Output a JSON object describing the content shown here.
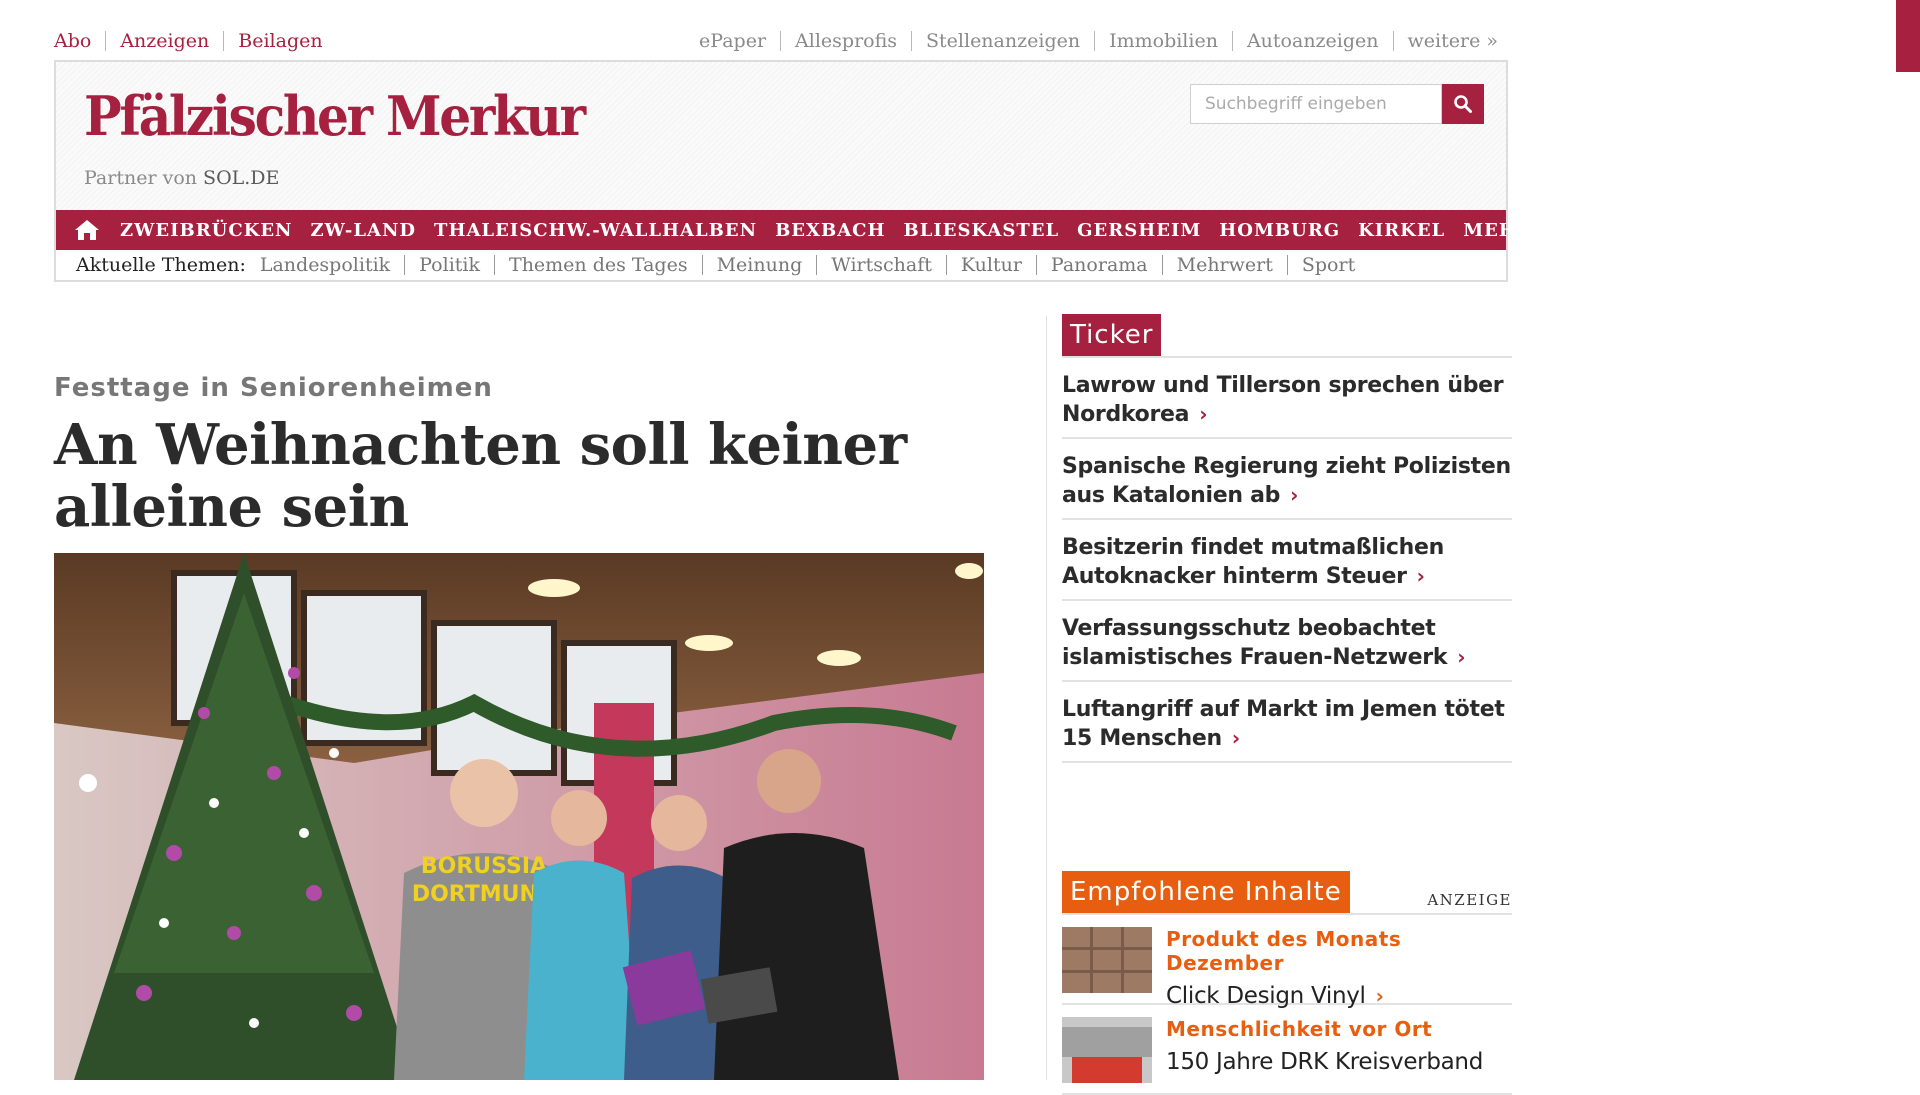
{
  "topbar": {
    "left_links": [
      "Abo",
      "Anzeigen",
      "Beilagen"
    ],
    "right_links": [
      "ePaper",
      "Allesprofis",
      "Stellenanzeigen",
      "Immobilien",
      "Autoanzeigen",
      "weitere »"
    ]
  },
  "header": {
    "logo": "Pfälzischer Merkur",
    "partner_prefix": "Partner von",
    "partner_name": "SOL.DE",
    "search_placeholder": "Suchbegriff eingeben"
  },
  "mainnav": {
    "items": [
      "ZWEIBRÜCKEN",
      "ZW-LAND",
      "THALEISCHW.-WALLHALBEN",
      "BEXBACH",
      "BLIESKASTEL",
      "GERSHEIM",
      "HOMBURG",
      "KIRKEL",
      "MEHR"
    ]
  },
  "themes": {
    "label": "Aktuelle Themen:",
    "items": [
      "Landespolitik",
      "Politik",
      "Themen des Tages",
      "Meinung",
      "Wirtschaft",
      "Kultur",
      "Panorama",
      "Mehrwert",
      "Sport"
    ]
  },
  "article": {
    "kicker": "Festtage in Seniorenheimen",
    "headline": "An Weihnachten soll keiner alleine sein",
    "photo_shirt_text_1": "BORUSSIA",
    "photo_shirt_text_2": "DORTMUND"
  },
  "ticker": {
    "title": "Ticker",
    "items": [
      "Lawrow und Tillerson sprechen über Nordkorea",
      "Spanische Regierung zieht Polizisten aus Katalonien ab",
      "Besitzerin findet mutmaßlichen Autoknacker hinterm Steuer",
      "Verfassungsschutz beobachtet islamistisches Frauen-Netzwerk",
      "Luftangriff auf Markt im Jemen tötet 15 Menschen"
    ]
  },
  "recommended": {
    "title": "Empfohlene Inhalte",
    "ad_label": "ANZEIGE",
    "items": [
      {
        "kicker": "Produkt des Monats Dezember",
        "title": "Click Design Vinyl"
      },
      {
        "kicker": "Menschlichkeit vor Ort",
        "title": "150 Jahre DRK Kreisverband"
      }
    ]
  },
  "colors": {
    "brand": "#a6213f",
    "accent_orange": "#e85e10"
  },
  "icons": {
    "home": "home-icon",
    "search": "search-icon",
    "chevron": "chevron-right-icon"
  }
}
